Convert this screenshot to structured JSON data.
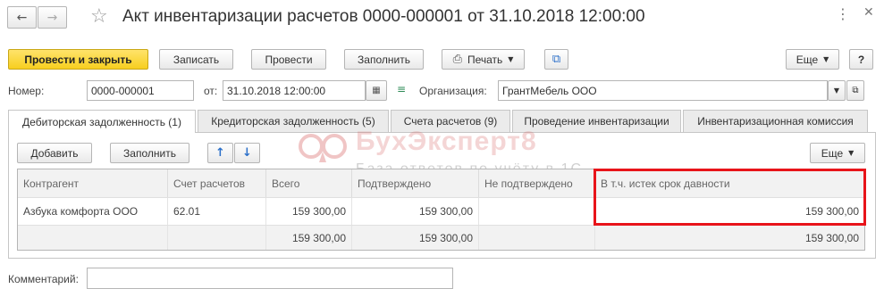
{
  "window": {
    "title": "Акт инвентаризации расчетов 0000-000001 от 31.10.2018 12:00:00",
    "back_icon": "arrow-left-icon",
    "forward_icon": "arrow-right-icon",
    "favorite_icon": "star-icon",
    "menu_icon": "dots-icon",
    "close_icon": "close-icon"
  },
  "toolbar": {
    "post_close": "Провести и закрыть",
    "save": "Записать",
    "post": "Провести",
    "fill": "Заполнить",
    "print": "Печать",
    "more": "Еще",
    "help": "?"
  },
  "form": {
    "number_label": "Номер:",
    "number_value": "0000-000001",
    "date_label": "от:",
    "date_value": "31.10.2018 12:00:00",
    "org_label": "Организация:",
    "org_value": "ГрантМебель ООО"
  },
  "tabs": [
    {
      "label": "Дебиторская задолженность (1)"
    },
    {
      "label": "Кредиторская задолженность (5)"
    },
    {
      "label": "Счета расчетов (9)"
    },
    {
      "label": "Проведение инвентаризации"
    },
    {
      "label": "Инвентаризационная комиссия"
    }
  ],
  "table_toolbar": {
    "add": "Добавить",
    "fill": "Заполнить",
    "more": "Еще"
  },
  "watermark": {
    "title": "БухЭксперт8",
    "subtitle": "База ответов по учёту в 1С"
  },
  "table": {
    "columns": [
      "Контрагент",
      "Счет расчетов",
      "Всего",
      "Подтверждено",
      "Не подтверждено",
      "В т.ч. истек срок давности"
    ],
    "rows": [
      [
        "Азбука комфорта ООО",
        "62.01",
        "159 300,00",
        "159 300,00",
        "",
        "159 300,00"
      ]
    ],
    "totals": [
      "",
      "",
      "159 300,00",
      "159 300,00",
      "",
      "159 300,00"
    ]
  },
  "comment": {
    "label": "Комментарий:",
    "value": ""
  },
  "colors": {
    "primary_button": "#f7cf1f",
    "highlight_border": "#e8141a",
    "watermark": "#d96a6a"
  }
}
